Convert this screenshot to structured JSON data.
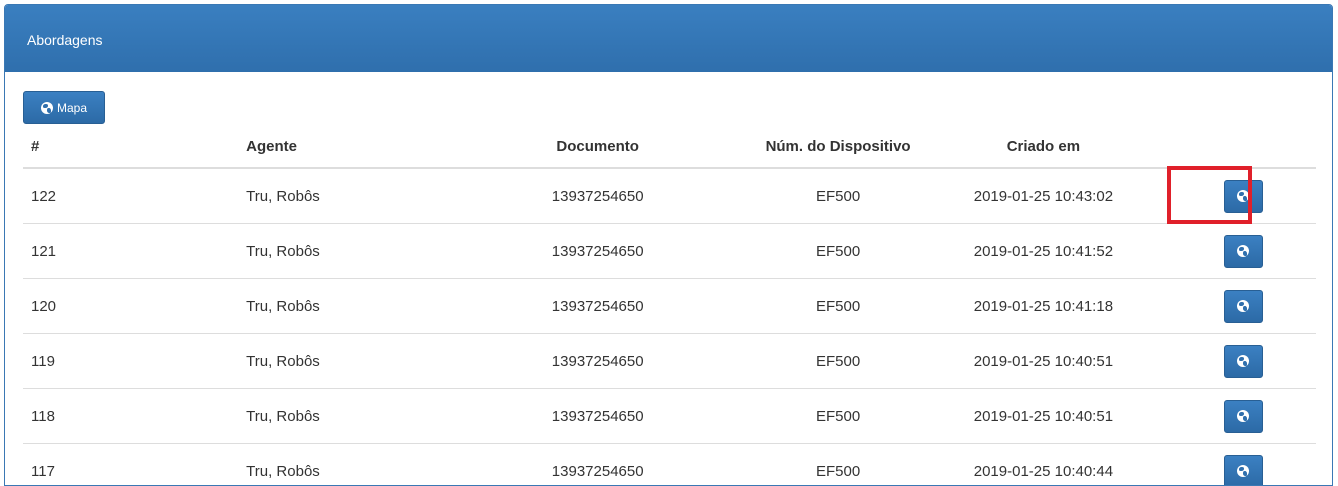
{
  "panel": {
    "title": "Abordagens"
  },
  "toolbar": {
    "map_button_label": "Mapa",
    "map_button_icon": "globe-icon"
  },
  "table": {
    "headers": {
      "id": "#",
      "agent": "Agente",
      "document": "Documento",
      "device": "Núm. do Dispositivo",
      "created": "Criado em"
    },
    "rows": [
      {
        "id": "122",
        "agent": "Tru, Robôs",
        "document": "13937254650",
        "device": "EF500",
        "created": "2019-01-25 10:43:02"
      },
      {
        "id": "121",
        "agent": "Tru, Robôs",
        "document": "13937254650",
        "device": "EF500",
        "created": "2019-01-25 10:41:52"
      },
      {
        "id": "120",
        "agent": "Tru, Robôs",
        "document": "13937254650",
        "device": "EF500",
        "created": "2019-01-25 10:41:18"
      },
      {
        "id": "119",
        "agent": "Tru, Robôs",
        "document": "13937254650",
        "device": "EF500",
        "created": "2019-01-25 10:40:51"
      },
      {
        "id": "118",
        "agent": "Tru, Robôs",
        "document": "13937254650",
        "device": "EF500",
        "created": "2019-01-25 10:40:51"
      },
      {
        "id": "117",
        "agent": "Tru, Robôs",
        "document": "13937254650",
        "device": "EF500",
        "created": "2019-01-25 10:40:44"
      }
    ],
    "row_action_icon": "globe-icon"
  },
  "colors": {
    "header_bg": "#3a7fc0",
    "button_bg": "#2f6fad",
    "highlight_border": "#e0202a"
  }
}
